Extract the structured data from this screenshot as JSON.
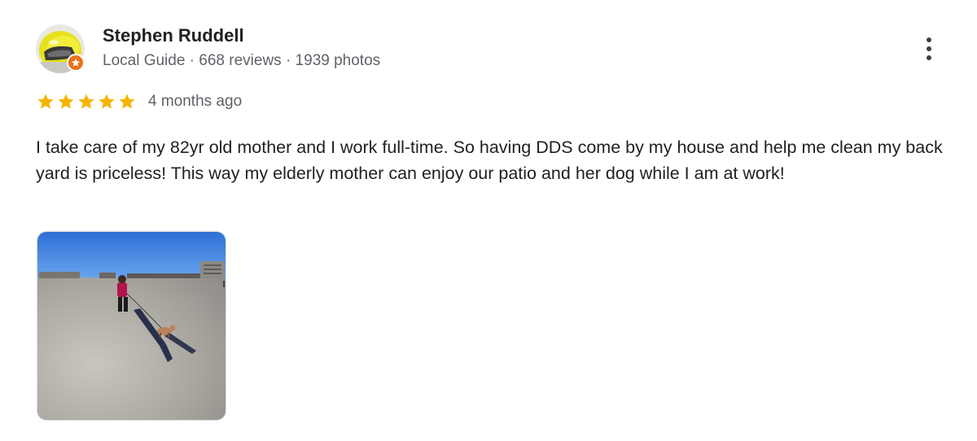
{
  "review": {
    "author": {
      "name": "Stephen Ruddell",
      "meta": "Local Guide · 668 reviews · 1939 photos",
      "avatar_icon": "motorcycle-helmet-avatar",
      "badge_icon": "local-guide-star-badge"
    },
    "rating": 5,
    "rating_max": 5,
    "date": "4 months ago",
    "text": "I take care of my 82yr old mother and I work full-time. So having DDS come by my house and help me clean my back yard is priceless! This way my elderly mother can enjoy our patio and her dog while I am at work!",
    "photo_icon": "beach-walk-photo",
    "more_icon": "more-vert-icon"
  },
  "colors": {
    "star": "#f4b400",
    "badge": "#e8711c",
    "secondary_text": "#5f6368"
  }
}
